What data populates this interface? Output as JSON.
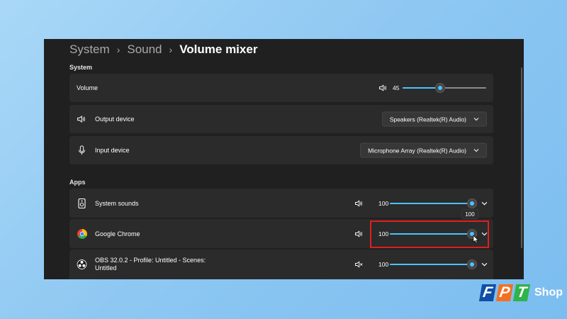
{
  "breadcrumb": [
    "System",
    "Sound",
    "Volume mixer"
  ],
  "sections": {
    "system": "System",
    "apps": "Apps"
  },
  "system": {
    "volume": {
      "label": "Volume",
      "value": "45",
      "level": 0.45,
      "icon": "speaker-icon"
    },
    "output": {
      "label": "Output device",
      "selected": "Speakers (Realtek(R) Audio)",
      "icon": "speaker-icon"
    },
    "input": {
      "label": "Input device",
      "selected": "Microphone Array (Realtek(R) Audio)",
      "icon": "microphone-icon"
    }
  },
  "apps": [
    {
      "name": "System sounds",
      "value": "100",
      "level": 1.0,
      "icon": "system-sounds-icon",
      "muted": false
    },
    {
      "name": "Google Chrome",
      "value": "100",
      "level": 1.0,
      "icon": "chrome-icon",
      "muted": false
    },
    {
      "name": "OBS 32.0.2 - Profile: Untitled - Scenes: Untitled",
      "value": "100",
      "level": 1.0,
      "icon": "obs-icon",
      "muted": true
    }
  ],
  "tooltip": "100",
  "brand": {
    "letters": [
      "F",
      "P",
      "T"
    ],
    "word": "Shop",
    "colors": [
      "#0f4fa8",
      "#f37021",
      "#2fb34a"
    ]
  },
  "colors": {
    "accent": "#4cc2ff",
    "highlight": "#e01e1e",
    "card": "#2b2b2b",
    "window": "#202020"
  }
}
